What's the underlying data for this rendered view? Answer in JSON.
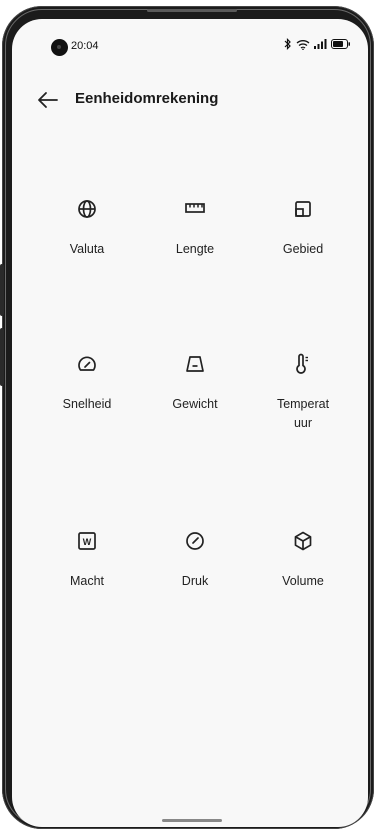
{
  "status": {
    "time": "20:04"
  },
  "header": {
    "title": "Eenheidomrekening"
  },
  "units": [
    {
      "label": "Valuta",
      "icon": "globe-icon"
    },
    {
      "label": "Lengte",
      "icon": "ruler-icon"
    },
    {
      "label": "Gebied",
      "icon": "area-icon"
    },
    {
      "label": "Snelheid",
      "icon": "speedometer-icon"
    },
    {
      "label": "Gewicht",
      "icon": "weight-icon"
    },
    {
      "label": "Temperat\nuur",
      "icon": "thermometer-icon"
    },
    {
      "label": "Macht",
      "icon": "power-icon",
      "badge": "W"
    },
    {
      "label": "Druk",
      "icon": "gauge-icon"
    },
    {
      "label": "Volume",
      "icon": "cube-icon"
    }
  ]
}
